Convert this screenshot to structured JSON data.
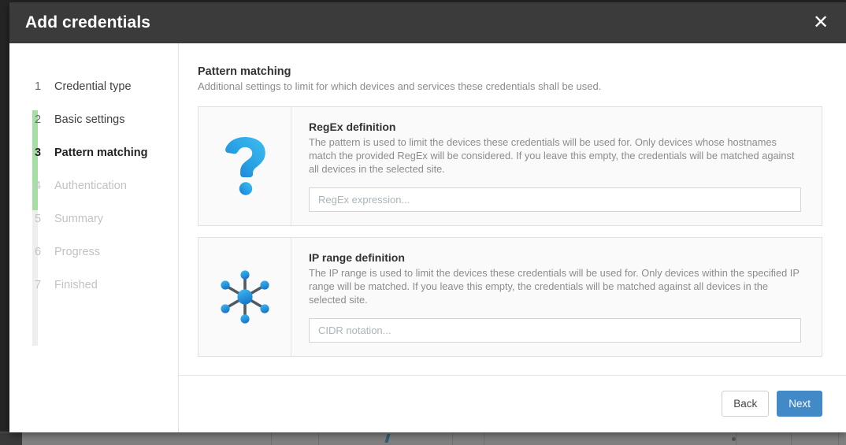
{
  "window": {
    "title": "Add credentials",
    "close_label": "✕",
    "close_icon": "close-icon"
  },
  "sidebar": {
    "steps": [
      {
        "num": "1",
        "label": "Credential type",
        "state": "done"
      },
      {
        "num": "2",
        "label": "Basic settings",
        "state": "done"
      },
      {
        "num": "3",
        "label": "Pattern matching",
        "state": "active"
      },
      {
        "num": "4",
        "label": "Authentication",
        "state": "upcoming"
      },
      {
        "num": "5",
        "label": "Summary",
        "state": "upcoming"
      },
      {
        "num": "6",
        "label": "Progress",
        "state": "upcoming"
      },
      {
        "num": "7",
        "label": "Finished",
        "state": "upcoming"
      }
    ],
    "progress_color": "#a6dfa4",
    "track_color": "#eeeeee"
  },
  "main": {
    "heading": "Pattern matching",
    "subheading": "Additional settings to limit for which devices and services these credentials shall be used.",
    "cards": [
      {
        "icon": "question-mark-icon",
        "title": "RegEx definition",
        "description": "The pattern is used to limit the devices these credentials will be used for. Only devices whose hostnames match the provided RegEx will be considered. If you leave this empty, the credentials will be matched against all devices in the selected site.",
        "input_placeholder": "RegEx expression...",
        "input_value": ""
      },
      {
        "icon": "network-hub-icon",
        "title": "IP range definition",
        "description": "The IP range is used to limit the devices these credentials will be used for. Only devices within the specified IP range will be matched. If you leave this empty, the credentials will be matched against all devices in the selected site.",
        "input_placeholder": "CIDR notation...",
        "input_value": ""
      }
    ]
  },
  "footer": {
    "back_label": "Back",
    "next_label": "Next",
    "primary_color": "#4189c7"
  },
  "icon_colors": {
    "blue_light": "#35b0ea",
    "blue_dark": "#1b83d4",
    "spoke_gray": "#4f5a61"
  }
}
